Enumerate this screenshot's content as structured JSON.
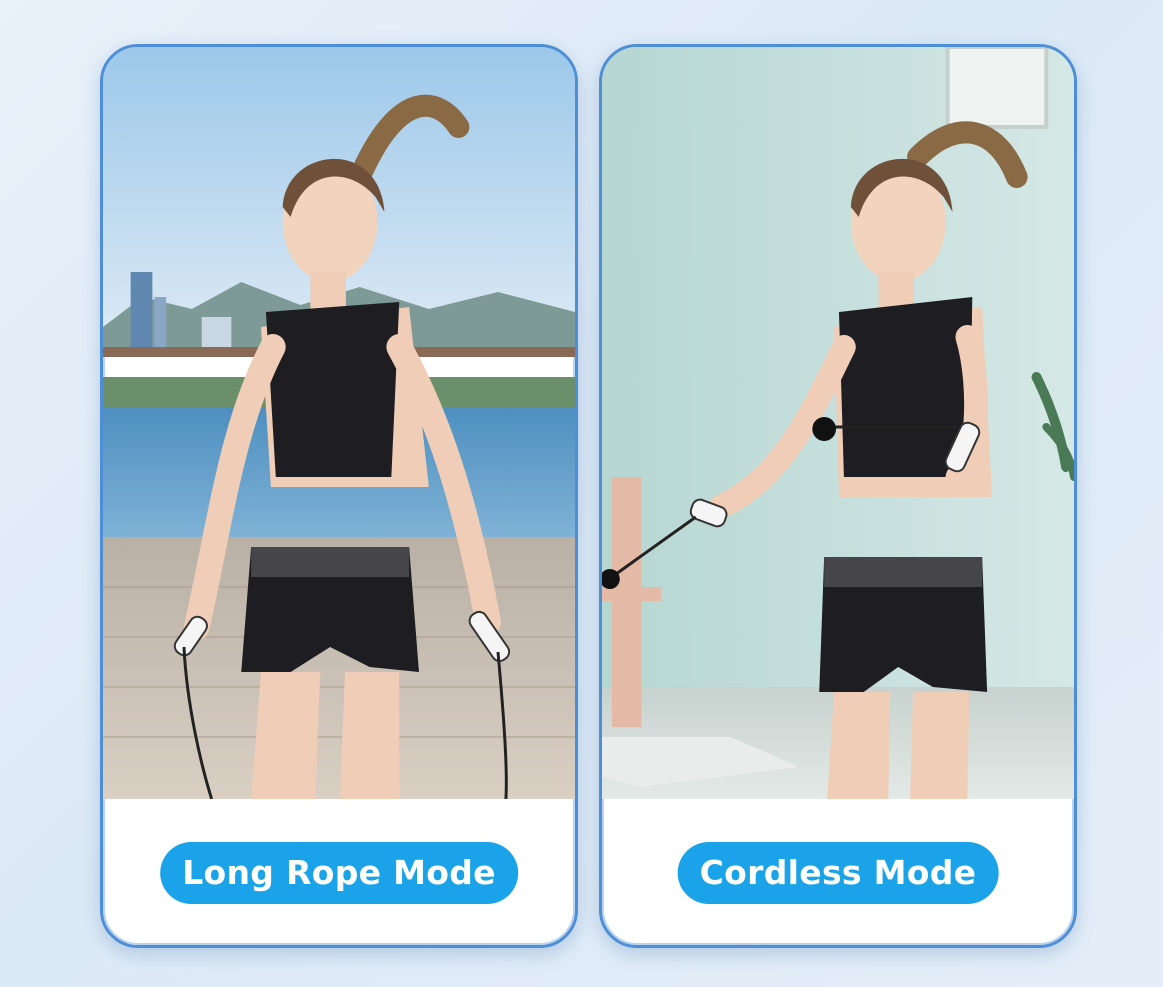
{
  "cards": [
    {
      "label": "Long Rope Mode"
    },
    {
      "label": "Cordless Mode"
    }
  ],
  "colors": {
    "badge": "#1aa3e8",
    "card_border": "#4d8ed6",
    "background": "#e4eef8"
  }
}
